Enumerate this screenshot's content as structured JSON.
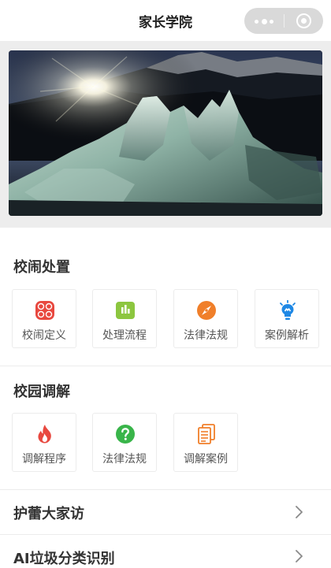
{
  "navbar": {
    "title": "家长学院"
  },
  "banner": {
    "alt": "glacier-ice-sunset"
  },
  "section_campus": {
    "title": "校闹处置",
    "items": [
      {
        "label": "校闹定义",
        "icon": "grid-icon",
        "color": "#e8483f"
      },
      {
        "label": "处理流程",
        "icon": "chart-icon",
        "color": "#8cc63f"
      },
      {
        "label": "法律法规",
        "icon": "compass-icon",
        "color": "#f07f2a"
      },
      {
        "label": "案例解析",
        "icon": "lightbulb-icon",
        "color": "#1e88e5"
      }
    ]
  },
  "section_mediation": {
    "title": "校园调解",
    "items": [
      {
        "label": "调解程序",
        "icon": "flame-icon",
        "color": "#e8483f"
      },
      {
        "label": "法律法规",
        "icon": "question-icon",
        "color": "#39b54a"
      },
      {
        "label": "调解案例",
        "icon": "document-icon",
        "color": "#f07f2a"
      }
    ]
  },
  "rows": [
    {
      "label": "护蕾大家访"
    },
    {
      "label": "AI垃圾分类识别"
    }
  ]
}
